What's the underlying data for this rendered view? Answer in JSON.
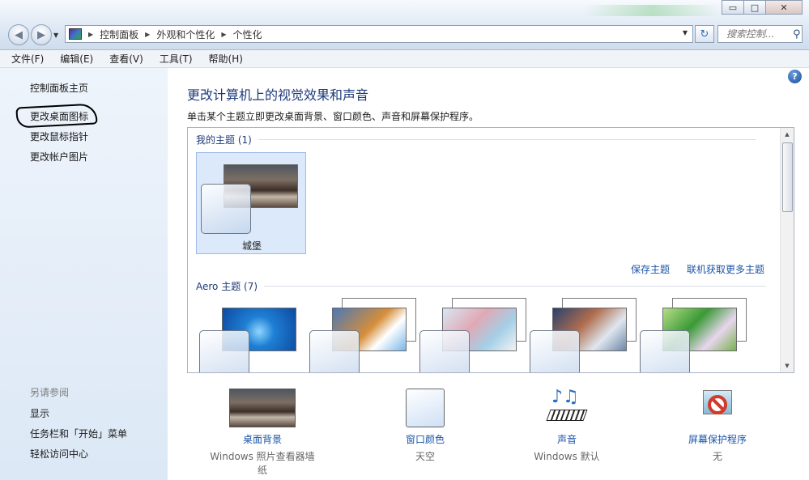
{
  "addressbar": {
    "crumbs": [
      "控制面板",
      "外观和个性化",
      "个性化"
    ],
    "search_placeholder": "搜索控制..."
  },
  "window_buttons": {
    "minimize": "▭",
    "maximize": "□",
    "close": "✕"
  },
  "menu": [
    "文件(F)",
    "编辑(E)",
    "查看(V)",
    "工具(T)",
    "帮助(H)"
  ],
  "sidebar": {
    "home": "控制面板主页",
    "links": [
      "更改桌面图标",
      "更改鼠标指针",
      "更改帐户图片"
    ],
    "see_also_title": "另请参阅",
    "see_also": [
      "显示",
      "任务栏和「开始」菜单",
      "轻松访问中心"
    ]
  },
  "main": {
    "title": "更改计算机上的视觉效果和声音",
    "description": "单击某个主题立即更改桌面背景、窗口颜色、声音和屏幕保护程序。",
    "my_themes_header": "我的主题 (1)",
    "my_theme_name": "城堡",
    "save_theme": "保存主题",
    "get_more": "联机获取更多主题",
    "aero_header": "Aero 主题 (7)"
  },
  "bottom": {
    "background": {
      "label": "桌面背景",
      "sub": "Windows 照片查看器墙纸"
    },
    "window_color": {
      "label": "窗口颜色",
      "sub": "天空"
    },
    "sound": {
      "label": "声音",
      "sub": "Windows 默认"
    },
    "screensaver": {
      "label": "屏幕保护程序",
      "sub": "无"
    }
  },
  "icons": [
    "back-arrow",
    "forward-arrow",
    "control-panel",
    "refresh",
    "search",
    "help",
    "scroll-up",
    "scroll-down"
  ]
}
